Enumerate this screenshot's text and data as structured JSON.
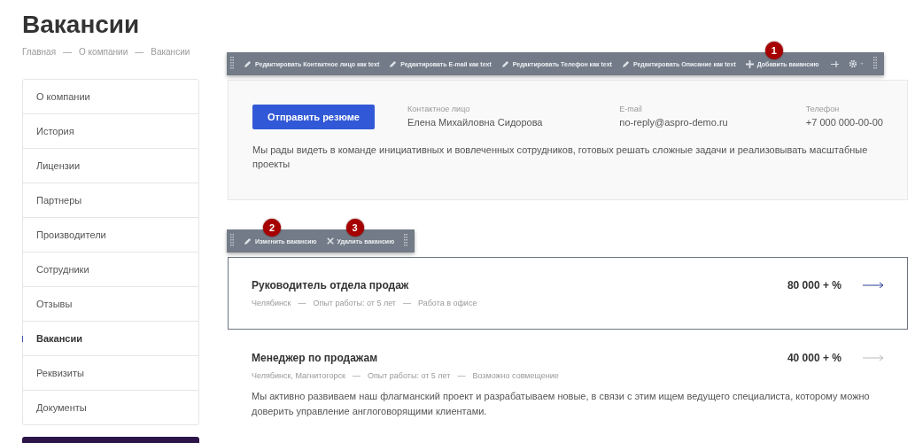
{
  "page": {
    "title": "Вакансии",
    "breadcrumbs": [
      "Главная",
      "О компании",
      "Вакансии"
    ],
    "separator": "—"
  },
  "sidebar": {
    "items": [
      {
        "label": "О компании",
        "selected": false
      },
      {
        "label": "История",
        "selected": false
      },
      {
        "label": "Лицензии",
        "selected": false
      },
      {
        "label": "Партнеры",
        "selected": false
      },
      {
        "label": "Производители",
        "selected": false
      },
      {
        "label": "Сотрудники",
        "selected": false
      },
      {
        "label": "Отзывы",
        "selected": false
      },
      {
        "label": "Вакансии",
        "selected": true
      },
      {
        "label": "Реквизиты",
        "selected": false
      },
      {
        "label": "Документы",
        "selected": false
      }
    ]
  },
  "edit_toolbar": {
    "badge": "1",
    "actions": [
      {
        "kind": "edit",
        "label": "Редактировать Контактное лицо как text"
      },
      {
        "kind": "edit",
        "label": "Редактировать E-mail как text"
      },
      {
        "kind": "edit",
        "label": "Редактировать Телефон как text"
      },
      {
        "kind": "edit",
        "label": "Редактировать Описание как text"
      },
      {
        "kind": "add",
        "label": "Добавить вакансию"
      }
    ]
  },
  "contact_card": {
    "button": "Отправить резюме",
    "fields": [
      {
        "label": "Контактное лицо",
        "value": "Елена Михайловна Сидорова"
      },
      {
        "label": "E-mail",
        "value": "no-reply@aspro-demo.ru"
      },
      {
        "label": "Телефон",
        "value": "+7 000 000-00-00"
      }
    ],
    "text": "Мы рады видеть в команде инициативных и вовлеченных сотрудников, готовых решать сложные задачи и реализовывать масштабные проекты"
  },
  "item_toolbar": {
    "actions": [
      {
        "kind": "edit",
        "label": "Изменить вакансию",
        "badge": "2"
      },
      {
        "kind": "delete",
        "label": "Удалить вакансию",
        "badge": "3"
      }
    ]
  },
  "vacancies": [
    {
      "title": "Руководитель отдела продаж",
      "salary": "80 000 + %",
      "meta": [
        "Челябинск",
        "Опыт работы: от 5 лет",
        "Работа в офисе"
      ],
      "separator": "—",
      "highlighted": true
    },
    {
      "title": "Менеджер по продажам",
      "salary": "40 000 + %",
      "meta": [
        "Челябинск, Магнитогорск",
        "Опыт работы: от 5 лет",
        "Возможно совмещение"
      ],
      "separator": "—",
      "text": "Мы активно развиваем наш флагманский проект и разрабатываем новые, в связи с этим ищем ведущего специалиста, которому можно доверить управление англоговорящими клиентами.",
      "highlighted": false
    }
  ]
}
